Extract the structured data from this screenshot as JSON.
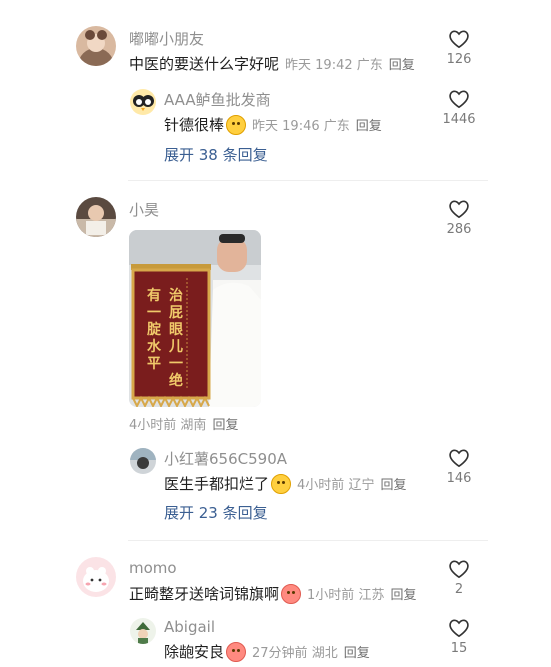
{
  "comments": [
    {
      "user": "嘟嘟小朋友",
      "text": "中医的要送什么字好呢",
      "time": "昨天 19:42",
      "location": "广东",
      "reply": "回复",
      "likes": "126",
      "replies": [
        {
          "user": "AAA鲈鱼批发商",
          "text": "针德很棒",
          "time": "昨天 19:46",
          "location": "广东",
          "reply": "回复",
          "likes": "1446"
        }
      ],
      "expand": "展开 38 条回复"
    },
    {
      "user": "小昊",
      "text": "",
      "image": {
        "banner_line1": "治屁眼儿一绝",
        "banner_line2": "有一腚水平"
      },
      "time": "4小时前",
      "location": "湖南",
      "reply": "回复",
      "likes": "286",
      "replies": [
        {
          "user": "小红薯656C590A",
          "text": "医生手都扣烂了",
          "time": "4小时前",
          "location": "辽宁",
          "reply": "回复",
          "likes": "146"
        }
      ],
      "expand": "展开 23 条回复"
    },
    {
      "user": "momo",
      "text": "正畸整牙送啥词锦旗啊",
      "time": "1小时前",
      "location": "江苏",
      "reply": "回复",
      "likes": "2",
      "replies": [
        {
          "user": "Abigail",
          "text": "除龅安良",
          "time": "27分钟前",
          "location": "湖北",
          "reply": "回复",
          "likes": "15"
        }
      ]
    }
  ]
}
